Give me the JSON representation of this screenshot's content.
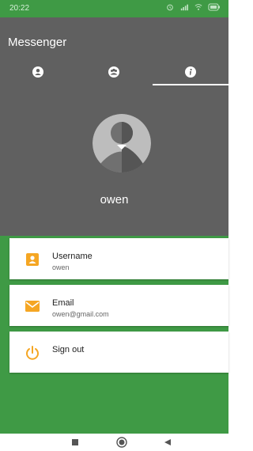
{
  "status_bar": {
    "time": "20:22",
    "icons": [
      "alarm-icon",
      "signal-icon",
      "wifi-icon",
      "battery-icon"
    ]
  },
  "app": {
    "title": "Messenger",
    "tabs": [
      {
        "name": "tab-contacts",
        "icon": "person-icon",
        "active": false
      },
      {
        "name": "tab-groups",
        "icon": "group-icon",
        "active": false
      },
      {
        "name": "tab-info",
        "icon": "info-icon",
        "active": true
      }
    ]
  },
  "profile": {
    "username": "owen",
    "avatar": "avatar-icon"
  },
  "details": [
    {
      "icon": "badge-icon",
      "label": "Username",
      "value": "owen"
    },
    {
      "icon": "mail-icon",
      "label": "Email",
      "value": "owen@gmail.com"
    },
    {
      "icon": "power-icon",
      "label": "Sign out",
      "value": ""
    }
  ],
  "colors": {
    "status_bar": "#3f9a45",
    "app_bar": "#606060",
    "accent": "#f5a623",
    "background_green": "#3f9a45"
  },
  "nav": {
    "buttons": [
      "recents-button",
      "home-button",
      "back-button"
    ]
  }
}
